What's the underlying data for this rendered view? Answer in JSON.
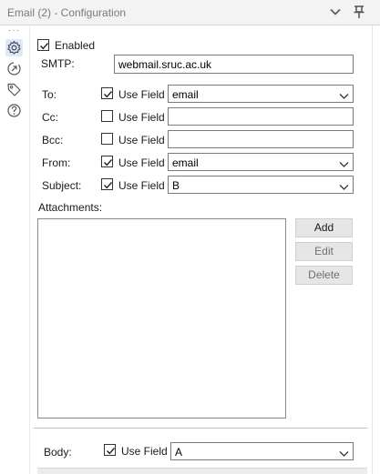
{
  "window": {
    "title": "Email (2) - Configuration"
  },
  "tool_rail": {
    "items": [
      "gear-icon",
      "connection-icon",
      "tag-icon",
      "help-icon"
    ],
    "active": "gear-icon"
  },
  "form": {
    "enabled": {
      "label": "Enabled",
      "checked": true
    },
    "smtp": {
      "label": "SMTP:",
      "value": "webmail.sruc.ac.uk"
    },
    "to": {
      "label": "To:",
      "use_field_label": "Use Field",
      "use_field": true,
      "value": "email"
    },
    "cc": {
      "label": "Cc:",
      "use_field_label": "Use Field",
      "use_field": false,
      "value": ""
    },
    "bcc": {
      "label": "Bcc:",
      "use_field_label": "Use Field",
      "use_field": false,
      "value": ""
    },
    "from": {
      "label": "From:",
      "use_field_label": "Use Field",
      "use_field": true,
      "value": "email"
    },
    "subject": {
      "label": "Subject:",
      "use_field_label": "Use Field",
      "use_field": true,
      "value": "B"
    },
    "attachments": {
      "label": "Attachments:",
      "items": [],
      "buttons": {
        "add": "Add",
        "edit": "Edit",
        "delete": "Delete"
      }
    },
    "body": {
      "label": "Body:",
      "use_field_label": "Use Field",
      "use_field": true,
      "value": "A"
    }
  },
  "colors": {
    "active_icon_bg": "#dfe8f4",
    "icon_stroke": "#3c4a5e"
  }
}
